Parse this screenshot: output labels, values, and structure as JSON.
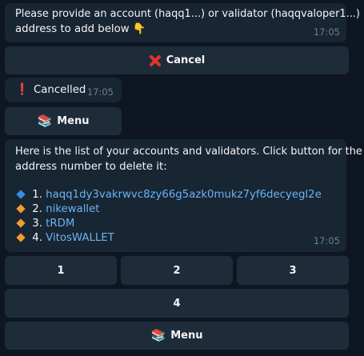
{
  "colors": {
    "background": "#0e1621",
    "bubble": "#182533",
    "button": "#1e2c3a",
    "link": "#6ab3f3",
    "timestamp": "#6d7f8f",
    "blue_diamond": "#3a8ee6",
    "orange_diamond": "#f39c2f",
    "cancel_icon": "#e0352b"
  },
  "messages": {
    "prompt": {
      "line1": "Please provide an account (haqq1...) or validator (haqqvaloper1...)",
      "line2": "address to add below 👇",
      "time": "17:05"
    },
    "cancelled": {
      "icon": "❗",
      "text": "Cancelled",
      "time": "17:05"
    },
    "list": {
      "intro_line1": "Here is the list of your accounts and validators. Click button for the",
      "intro_line2": "address number to delete it:",
      "accounts": [
        {
          "number": "1.",
          "name": "haqq1dy3vakrwvc8zy66g5azk0mukz7yf6decyegl2e",
          "icon": "blue-diamond-icon"
        },
        {
          "number": "2.",
          "name": "nikewallet",
          "icon": "orange-diamond-icon"
        },
        {
          "number": "3.",
          "name": "tRDM",
          "icon": "orange-diamond-icon"
        },
        {
          "number": "4.",
          "name": "VitosWALLET",
          "icon": "orange-diamond-icon"
        }
      ],
      "time": "17:05"
    }
  },
  "buttons": {
    "cancel": {
      "label": "Cancel",
      "icon": "cross-mark-icon"
    },
    "menu_top": {
      "label": "Menu",
      "icon": "📚"
    },
    "num1": "1",
    "num2": "2",
    "num3": "3",
    "num4": "4",
    "menu_bottom": {
      "label": "Menu",
      "icon": "📚"
    }
  }
}
